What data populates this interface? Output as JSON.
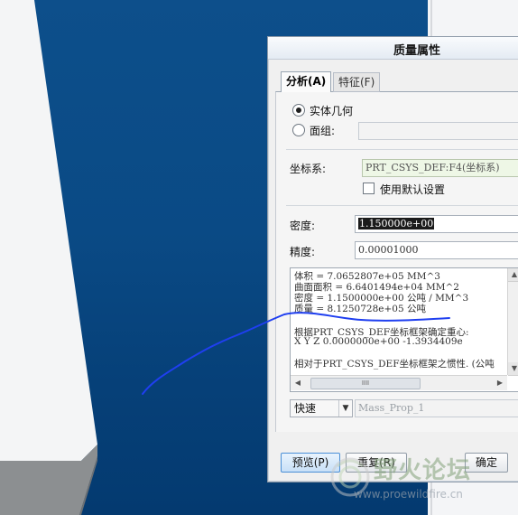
{
  "dialog": {
    "title": "质量属性",
    "tabs": [
      {
        "label": "分析(A)",
        "active": true
      },
      {
        "label": "特征(F)",
        "active": false
      }
    ],
    "geometry": {
      "solid_label": "实体几何",
      "group_label": "面组:",
      "solid_selected": true,
      "group_value": ""
    },
    "csys": {
      "label": "坐标系:",
      "value": "PRT_CSYS_DEF:F4(坐标系)"
    },
    "use_default": {
      "label": "使用默认设置",
      "checked": false
    },
    "density": {
      "label": "密度:",
      "value": "1.150000e+00"
    },
    "precision": {
      "label": "精度:",
      "value": "0.00001000"
    },
    "results": [
      "体积 =  7.0652807e+05  MM^3",
      "曲面面积 =  6.6401494e+04  MM^2",
      "密度 =  1.1500000e+00 公吨 / MM^3",
      "质量 =  8.1250728e+05 公吨",
      "",
      "根据PRT_CSYS_DEF坐标框架确定重心:",
      "X    Y    Z     0.0000000e+00 -1.3934409e",
      "",
      "相对于PRT_CSYS_DEF坐标框架之惯性.  (公吨"
    ],
    "scroll_glyph": "IIII",
    "mode": {
      "value": "快速"
    },
    "feature_name": {
      "value": "Mass_Prop_1"
    },
    "buttons": {
      "preview": "预览(P)",
      "repeat": "重复(R)",
      "ok": "确定"
    }
  },
  "watermark": {
    "text": "野火论坛",
    "url": "www.proewildfire.cn"
  },
  "colors": {
    "viewport_top": "#0d4f8b",
    "viewport_bottom": "#043a70",
    "annotation_stroke": "#1f3ff0"
  }
}
